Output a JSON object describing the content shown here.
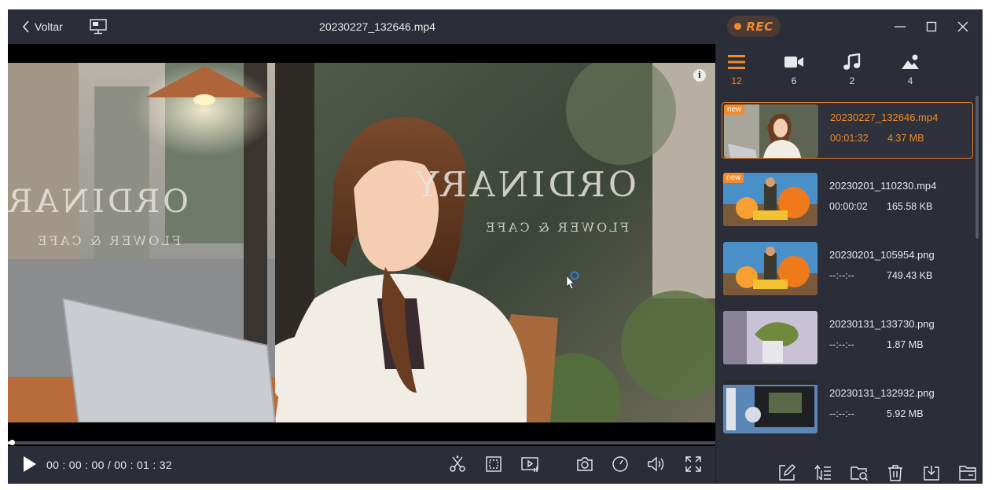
{
  "titlebar": {
    "back_label": "Voltar",
    "file_title": "20230227_132646.mp4",
    "rec_label": "REC"
  },
  "player": {
    "time_display": "00 : 00 : 00 / 00 : 01 : 32",
    "progress_fraction": 0.004,
    "info_label": "i"
  },
  "categories": [
    {
      "icon": "list-icon",
      "count": "12"
    },
    {
      "icon": "video-camera-icon",
      "count": "6"
    },
    {
      "icon": "music-note-icon",
      "count": "2"
    },
    {
      "icon": "image-icon",
      "count": "4"
    }
  ],
  "files": [
    {
      "name": "20230227_132646.mp4",
      "duration": "00:01:32",
      "size": "4.37 MB",
      "badge": "new"
    },
    {
      "name": "20230201_110230.mp4",
      "duration": "00:00:02",
      "size": "165.58 KB",
      "badge": "new"
    },
    {
      "name": "20230201_105954.png",
      "duration": "--:--:--",
      "size": "749.43 KB",
      "badge": ""
    },
    {
      "name": "20230131_133730.png",
      "duration": "--:--:--",
      "size": "1.87 MB",
      "badge": ""
    },
    {
      "name": "20230131_132932.png",
      "duration": "--:--:--",
      "size": "5.92 MB",
      "badge": ""
    }
  ],
  "video_text": {
    "sign_main": "ORDINARY",
    "sign_sub": "FLOWER & CAFE"
  },
  "colors": {
    "accent": "#f08a2c",
    "background": "#2b2e38",
    "text": "#e6e8ee"
  }
}
